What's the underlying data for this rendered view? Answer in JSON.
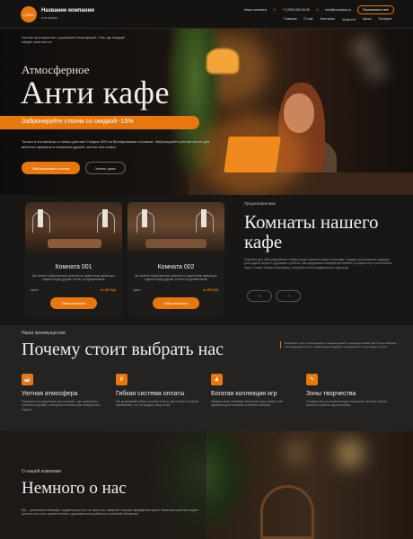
{
  "header": {
    "logo": "LOGO",
    "company_name": "Название компании",
    "slogan": "Антикафе",
    "contacts_label": "Наши контакты",
    "phone": "+7 (000) 000-00-00",
    "email": "mail@company.ru",
    "callback_button": "Перезвоните мне",
    "nav": [
      "Главная",
      "О нас",
      "Контакты",
      "Услуги",
      "Цены",
      "Галерея"
    ]
  },
  "hero": {
    "pre_text": "Уютное пространство с домашней атмосферой. Там, где каждый найдёт своё место!",
    "subtitle": "Атмосферное",
    "title": "Анти кафе",
    "promo": "Забронируйте столик со скидкой -15%",
    "description": "Только в эти месяцы и только для вас! Скидка 15% на бронирование столиков. Забронируйте уютное место для весёлого времени в компании друзей, коллег или семьи.",
    "book_button": "Забронировать столик",
    "prices_button": "Узнать цены"
  },
  "rooms": {
    "pre": "Предлагаем вам",
    "title": "Комнаты нашего кафе",
    "description": "Откройте для себя уединённые тематические комнаты нашего антикафе. Каждое пространство подходит для отдыха, встреч с друзьями и работы. Мы предлагаем комфортную мебель, игровую зону и настольные игры, а также тёплую атмосферу, в которой хочется задержаться подольше.",
    "arrow_left": "‹",
    "arrow_right": "›",
    "cards": [
      {
        "title": "Комната 001",
        "desc": "Вы можете забронировать комнату на нужное вам время для отдыха в кругу друзей, коллег и родственников.",
        "price_label": "Цена:",
        "price": "от 250 Руб.",
        "button": "Забронировать"
      },
      {
        "title": "Комната 002",
        "desc": "Вы можете забронировать комнату на нужное вам время для отдыха в кругу друзей, коллег и родственников.",
        "price_label": "Цена:",
        "price": "от 250 Руб.",
        "button": "Забронировать"
      }
    ]
  },
  "advantages": {
    "pre": "Наши преимущества",
    "title": "Почему стоит выбрать нас",
    "note": "Выбирайте нас и наслаждайтесь выдающимися преимуществами! Мы предоставляем неповторимые услуги, гарантируем комфорт и безопасность для наших гостей.",
    "items": [
      {
        "icon": "☕",
        "title": "Уютная атмосфера",
        "desc": "Погрузитесь в уникальное пространство, где гармонично сочетаются дизайн, освещение и мебель для комфортного отдыха."
      },
      {
        "icon": "₽",
        "title": "Гибкая система оплаты",
        "desc": "Мы предлагаем гибкую систему оплаты, где платите за время пребывания, а не за каждую чашку кофе."
      },
      {
        "icon": "♟",
        "title": "Богатая коллекция игр",
        "desc": "Найдите свою любимую настольную игру среди сотен вариантов для компаний и весёлых вечеров."
      },
      {
        "icon": "✎",
        "title": "Зоны творчества",
        "desc": "Специальные пространства для творческих занятий, мастер-классов и работы над проектами."
      }
    ]
  },
  "about": {
    "pre": "О нашей компании",
    "title": "Немного о нас",
    "desc": "Мы — уникальное антикафе, созданное для тех, кто ценит уют, общение и хорошо проведённое время. Наше пространство открыто для всех, кто хочет провести вечер с друзьями или поработать в спокойной обстановке."
  }
}
